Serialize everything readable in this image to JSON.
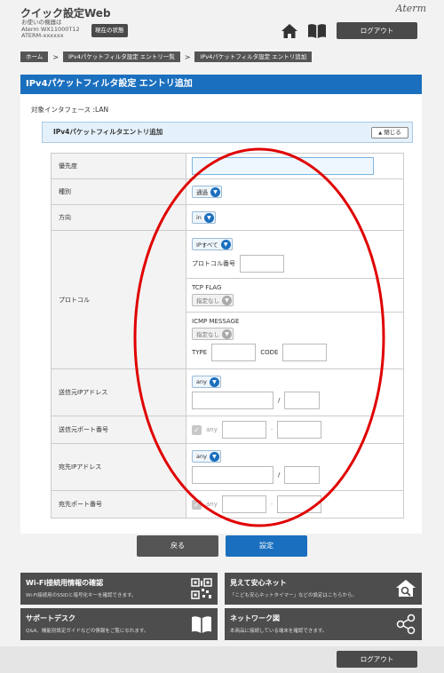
{
  "header": {
    "app_title": "クイック設定Web",
    "device_label": "お使いの機器は",
    "device_model": "Aterm WX11000T12",
    "device_id": "ATERM-xxxxxx",
    "status_button": "現在の状態",
    "brand": "Aterm",
    "home_icon": "home-icon",
    "manual_icon": "book-icon",
    "logout": "ログアウト"
  },
  "breadcrumb": [
    "ホーム",
    "IPv4パケットフィルタ設定 エントリ一覧",
    "IPv4パケットフィルタ設定 エントリ追加"
  ],
  "breadcrumb_sep": ">",
  "page_title": "IPv4パケットフィルタ設定 エントリ追加",
  "interface_label": "対象インタフェース :LAN",
  "section": {
    "title": "IPv4パケットフィルタエントリ追加",
    "close_label": "閉じる",
    "close_chevron": "▲"
  },
  "form": {
    "priority": {
      "label": "優先度",
      "value": ""
    },
    "type": {
      "label": "種別",
      "value": "通過"
    },
    "direction": {
      "label": "方向",
      "value": "in"
    },
    "protocol": {
      "label": "プロトコル",
      "value": "IPすべて",
      "number_label": "プロトコル番号",
      "tcp_flag_label": "TCP FLAG",
      "tcp_flag_value": "指定なし",
      "icmp_label": "ICMP MESSAGE",
      "icmp_value": "指定なし",
      "type_label": "TYPE",
      "code_label": "CODE"
    },
    "src_ip": {
      "label": "送信元IPアドレス",
      "value": "any",
      "slash": "/"
    },
    "src_port": {
      "label": "送信元ポート番号",
      "any_label": "any",
      "dash": "-"
    },
    "dst_ip": {
      "label": "宛先IPアドレス",
      "value": "any",
      "slash": "/"
    },
    "dst_port": {
      "label": "宛先ポート番号",
      "any_label": "any",
      "dash": "-"
    }
  },
  "chevron_glyph": "▼",
  "check_glyph": "✓",
  "buttons": {
    "back": "戻る",
    "set": "設定"
  },
  "tiles": [
    {
      "title": "Wi-Fi接続用情報の確認",
      "desc": "Wi-Fi接続用のSSIDと暗号化キーを確認できます。",
      "icon": "qr-code-icon"
    },
    {
      "title": "見えて安心ネット",
      "desc": "「こども安心ネットタイマー」などの設定はこちらから。",
      "icon": "home-search-icon"
    },
    {
      "title": "サポートデスク",
      "desc": "Q&A、機能別設定ガイドなどの情報をご覧になれます。",
      "icon": "book-icon"
    },
    {
      "title": "ネットワーク図",
      "desc": "本商品に接続している端末を確認できます。",
      "icon": "network-icon"
    }
  ],
  "footer": {
    "logout": "ログアウト"
  },
  "colors": {
    "accent": "#1a6fbe",
    "dark": "#4d4d4d",
    "annotation": "#e00000"
  }
}
